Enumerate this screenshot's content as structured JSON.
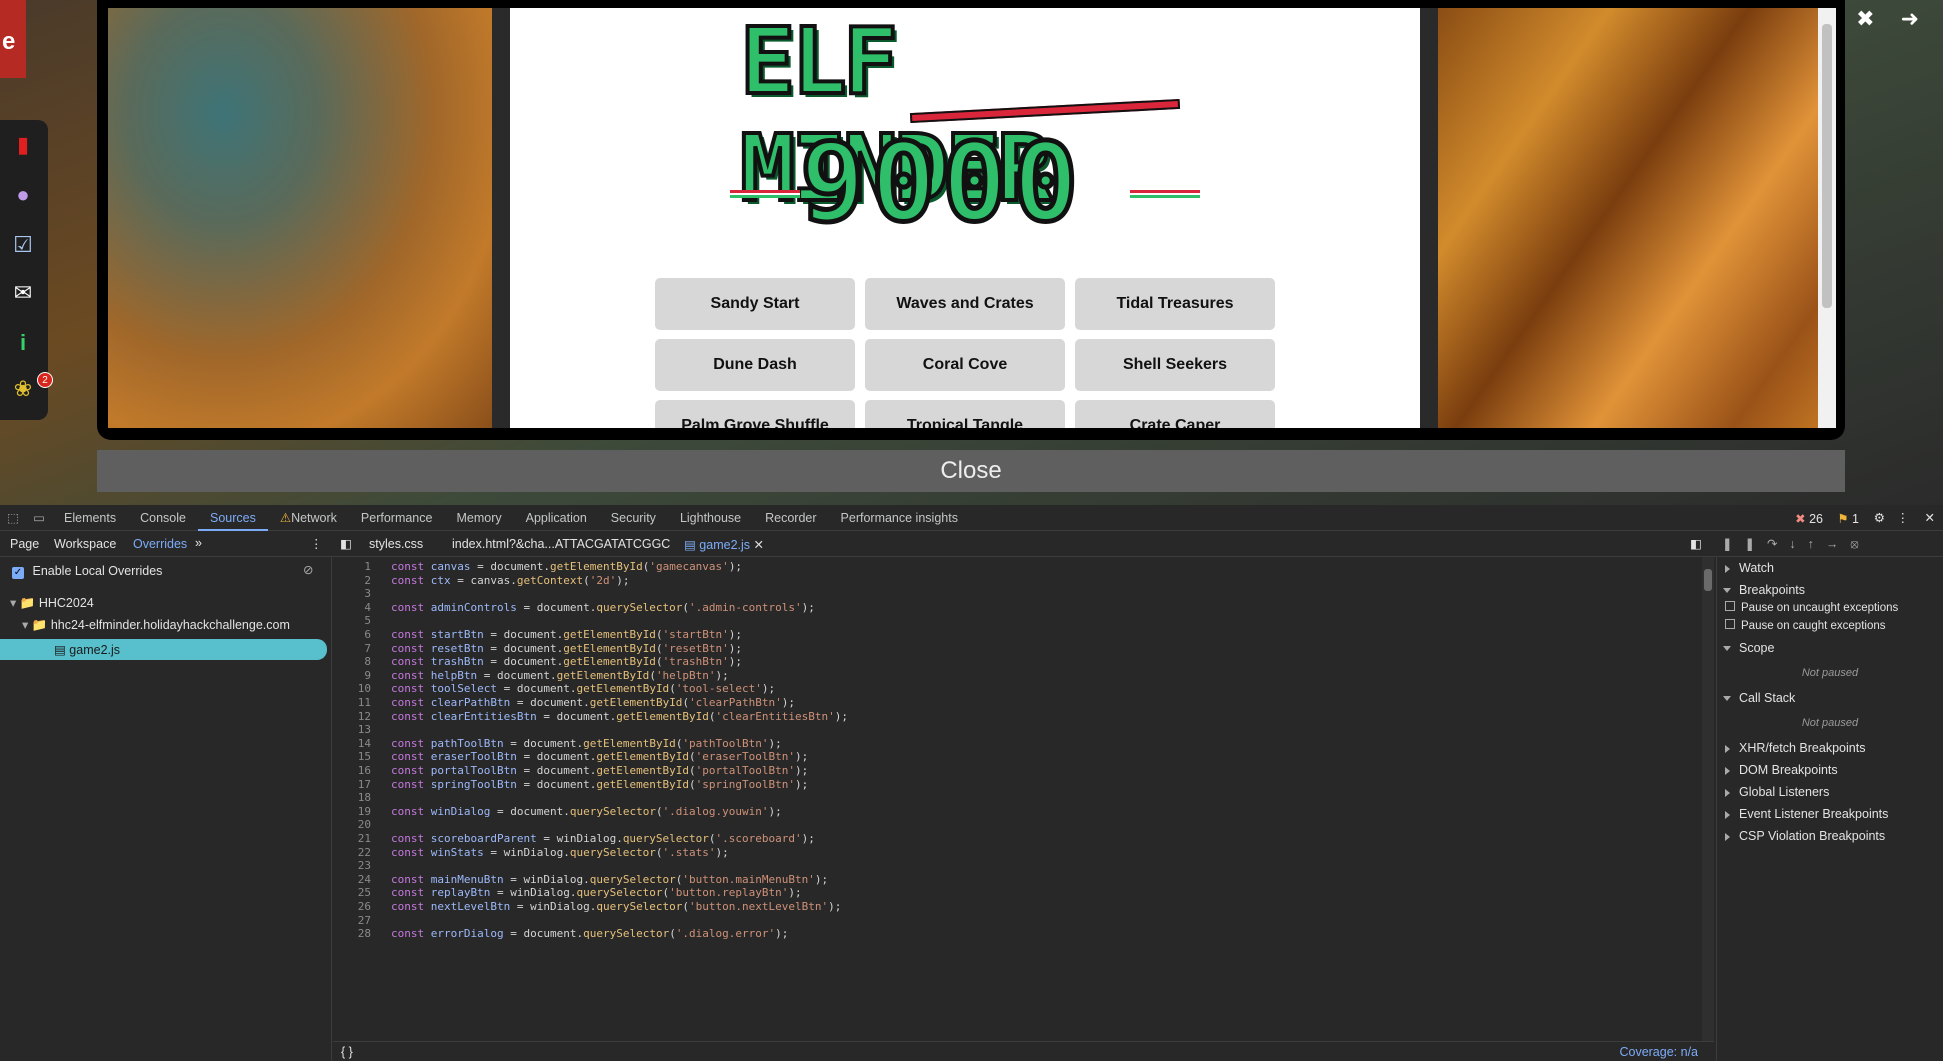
{
  "game": {
    "corner_sign": "e",
    "logo_line1": "ELF MINDER",
    "logo_line2": "9000",
    "levels": [
      "Sandy Start",
      "Waves and Crates",
      "Tidal Treasures",
      "Dune Dash",
      "Coral Cove",
      "Shell Seekers",
      "Palm Grove Shuffle",
      "Tropical Tangle",
      "Crate Caper"
    ],
    "close_label": "Close",
    "badge_count": "2"
  },
  "devtools": {
    "tabs": [
      "Elements",
      "Console",
      "Sources",
      "Network",
      "Performance",
      "Memory",
      "Application",
      "Security",
      "Lighthouse",
      "Recorder",
      "Performance insights"
    ],
    "active_tab": "Sources",
    "error_count": "26",
    "warning_count": "1",
    "nav_tabs": [
      "Page",
      "Workspace",
      "Overrides"
    ],
    "file_tabs": [
      "styles.css",
      "index.html?&cha...ATTACGATATCGGC",
      "game2.js"
    ],
    "enable_overrides": "Enable Local Overrides",
    "tree": [
      "HHC2024",
      "hhc24-elfminder.holidayhackchallenge.com",
      "game2.js"
    ],
    "right_sections": [
      "Watch",
      "Breakpoints",
      "Scope",
      "Call Stack",
      "XHR/fetch Breakpoints",
      "DOM Breakpoints",
      "Global Listeners",
      "Event Listener Breakpoints",
      "CSP Violation Breakpoints"
    ],
    "pause_uncaught": "Pause on uncaught exceptions",
    "pause_caught": "Pause on caught exceptions",
    "not_paused": "Not paused",
    "coverage": "Coverage: n/a",
    "format_icon": "{ }"
  },
  "code": [
    "const canvas = document.getElementById('gamecanvas');",
    "const ctx = canvas.getContext('2d');",
    "",
    "const adminControls = document.querySelector('.admin-controls');",
    "",
    "const startBtn = document.getElementById('startBtn');",
    "const resetBtn = document.getElementById('resetBtn');",
    "const trashBtn = document.getElementById('trashBtn');",
    "const helpBtn = document.getElementById('helpBtn');",
    "const toolSelect = document.getElementById('tool-select');",
    "const clearPathBtn = document.getElementById('clearPathBtn');",
    "const clearEntitiesBtn = document.getElementById('clearEntitiesBtn');",
    "",
    "const pathToolBtn = document.getElementById('pathToolBtn');",
    "const eraserToolBtn = document.getElementById('eraserToolBtn');",
    "const portalToolBtn = document.getElementById('portalToolBtn');",
    "const springToolBtn = document.getElementById('springToolBtn');",
    "",
    "const winDialog = document.querySelector('.dialog.youwin');",
    "",
    "const scoreboardParent = winDialog.querySelector('.scoreboard');",
    "const winStats = winDialog.querySelector('.stats');",
    "",
    "const mainMenuBtn = winDialog.querySelector('button.mainMenuBtn');",
    "const replayBtn = winDialog.querySelector('button.replayBtn');",
    "const nextLevelBtn = winDialog.querySelector('button.nextLevelBtn');",
    "",
    "const errorDialog = document.querySelector('.dialog.error');"
  ]
}
